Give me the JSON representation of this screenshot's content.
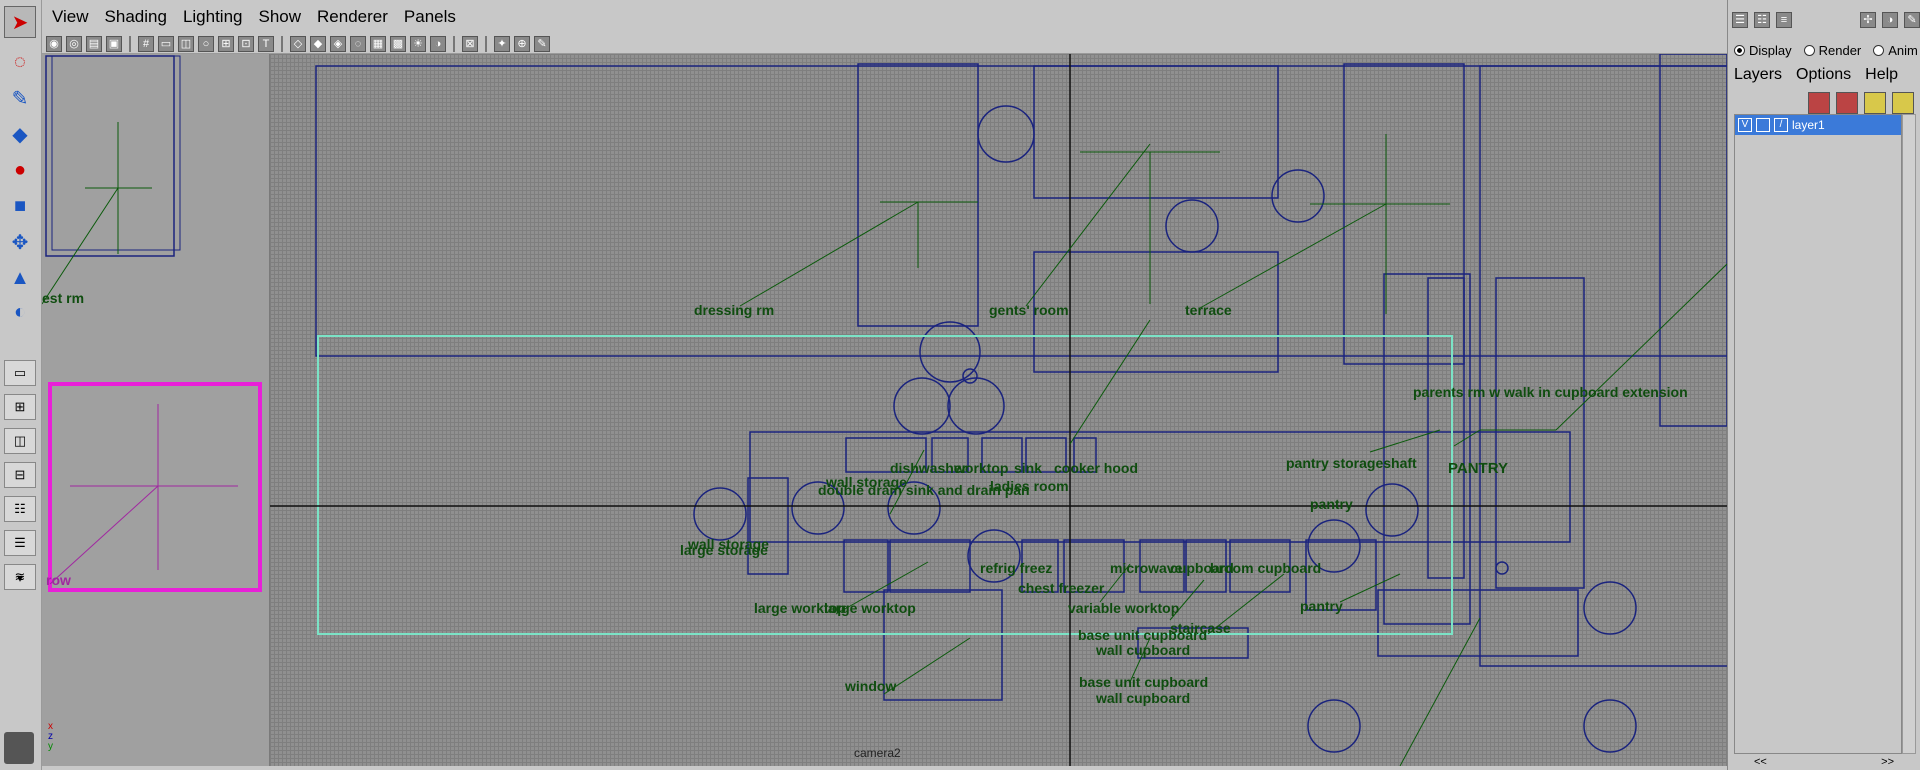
{
  "menu": [
    "View",
    "Shading",
    "Lighting",
    "Show",
    "Renderer",
    "Panels"
  ],
  "camera_label": "camera2",
  "thumb_labels": {
    "top_partial": "est rm",
    "bottom_partial": "row"
  },
  "viewport_labels": [
    "dressing rm",
    "gents' room",
    "terrace",
    "parents rm w walk in cupboard extension",
    "pantry storageshaft",
    "PANTRY",
    "pantry",
    "pantry",
    "dishwasher",
    "worktop",
    "sink",
    "cooker hood",
    "wall storage",
    "double drain sink and drain pan",
    "ladies room",
    "wall storage",
    "large storage",
    "refrig freez",
    "chest freezer",
    "microwave",
    "cupboard",
    "broom cupboard",
    "large worktop",
    "large worktop",
    "variable worktop",
    "base unit cupboard",
    "wall cupboard",
    "staircase",
    "window",
    "base unit cupboard",
    "wall cupboard"
  ],
  "right_panel": {
    "modes": [
      "Display",
      "Render",
      "Anim"
    ],
    "menu": [
      "Layers",
      "Options",
      "Help"
    ],
    "layer": {
      "visible": "V",
      "name": "layer1"
    },
    "nav_left": "<<",
    "nav_right": ">>"
  },
  "axis": {
    "x": "x",
    "y": "y",
    "z": "z"
  }
}
